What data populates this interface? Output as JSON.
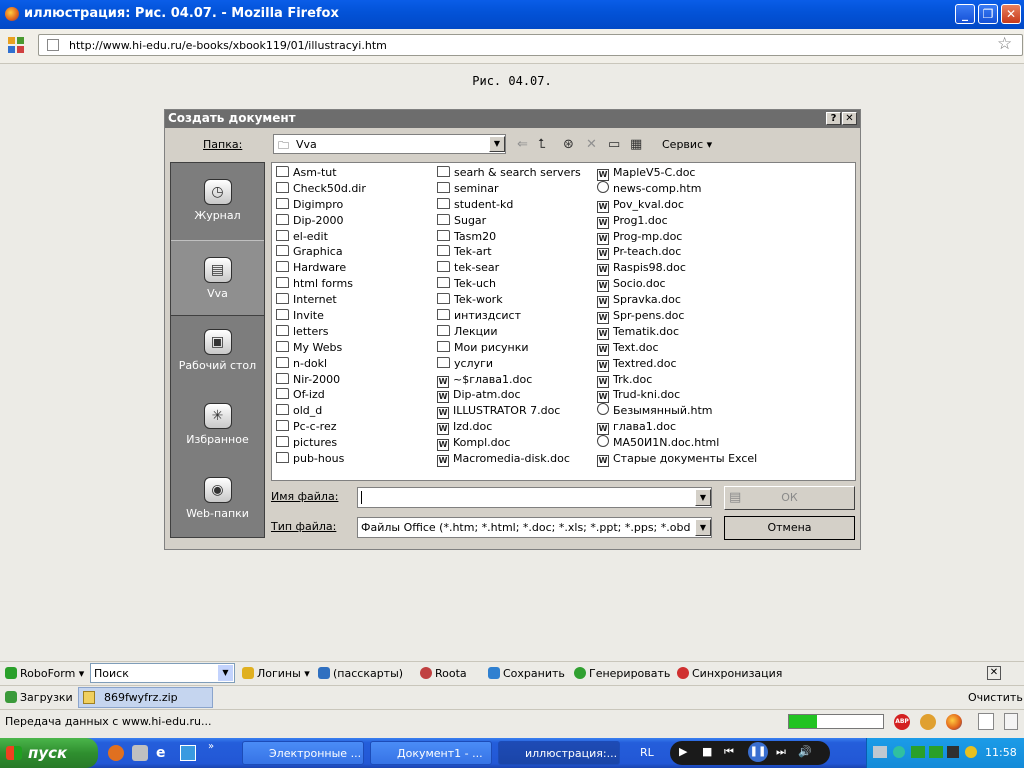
{
  "window": {
    "title": "иллюстрация: Рис. 04.07. - Mozilla Firefox"
  },
  "nav": {
    "url": "http://www.hi-edu.ru/e-books/xbook119/01/illustracyi.htm"
  },
  "page": {
    "caption": "Рис. 04.07."
  },
  "dialog": {
    "title": "Создать документ",
    "folder_label": "Папка:",
    "folder_value": "Vva",
    "tools_label": "Сервис",
    "places": [
      "Журнал",
      "Vva",
      "Рабочий стол",
      "Избранное",
      "Web-папки"
    ],
    "files": {
      "col1": [
        {
          "name": "Asm-tut",
          "type": "folder"
        },
        {
          "name": "Check50d.dir",
          "type": "folder"
        },
        {
          "name": "Digimpro",
          "type": "folder"
        },
        {
          "name": "Dip-2000",
          "type": "folder"
        },
        {
          "name": "el-edit",
          "type": "folder"
        },
        {
          "name": "Graphica",
          "type": "folder"
        },
        {
          "name": "Hardware",
          "type": "folder"
        },
        {
          "name": "html forms",
          "type": "folder"
        },
        {
          "name": "Internet",
          "type": "folder"
        },
        {
          "name": "Invite",
          "type": "folder"
        },
        {
          "name": "letters",
          "type": "folder"
        },
        {
          "name": "My Webs",
          "type": "folder"
        },
        {
          "name": "n-dokl",
          "type": "folder"
        },
        {
          "name": "Nir-2000",
          "type": "folder"
        },
        {
          "name": "Of-izd",
          "type": "folder"
        },
        {
          "name": "old_d",
          "type": "folder"
        },
        {
          "name": "Pc-c-rez",
          "type": "folder"
        },
        {
          "name": "pictures",
          "type": "folder"
        },
        {
          "name": "pub-hous",
          "type": "folder"
        }
      ],
      "col2": [
        {
          "name": "searh & search servers",
          "type": "folder"
        },
        {
          "name": "seminar",
          "type": "folder"
        },
        {
          "name": "student-kd",
          "type": "folder"
        },
        {
          "name": "Sugar",
          "type": "folder"
        },
        {
          "name": "Tasm20",
          "type": "folder"
        },
        {
          "name": "Tek-art",
          "type": "folder"
        },
        {
          "name": "tek-sear",
          "type": "folder"
        },
        {
          "name": "Tek-uch",
          "type": "folder"
        },
        {
          "name": "Tek-work",
          "type": "folder"
        },
        {
          "name": "интиздсист",
          "type": "folder"
        },
        {
          "name": "Лекции",
          "type": "folder"
        },
        {
          "name": "Мои рисунки",
          "type": "folder"
        },
        {
          "name": "услуги",
          "type": "folder"
        },
        {
          "name": "~$глава1.doc",
          "type": "doc"
        },
        {
          "name": "Dip-atm.doc",
          "type": "doc"
        },
        {
          "name": "ILLUSTRATOR 7.doc",
          "type": "doc"
        },
        {
          "name": "Izd.doc",
          "type": "doc"
        },
        {
          "name": "Kompl.doc",
          "type": "doc"
        },
        {
          "name": "Macromedia-disk.doc",
          "type": "doc"
        }
      ],
      "col3": [
        {
          "name": "MapleV5-C.doc",
          "type": "doc"
        },
        {
          "name": "news-comp.htm",
          "type": "htm"
        },
        {
          "name": "Pov_kval.doc",
          "type": "doc"
        },
        {
          "name": "Prog1.doc",
          "type": "doc"
        },
        {
          "name": "Prog-mp.doc",
          "type": "doc"
        },
        {
          "name": "Pr-teach.doc",
          "type": "doc"
        },
        {
          "name": "Raspis98.doc",
          "type": "doc"
        },
        {
          "name": "Socio.doc",
          "type": "doc"
        },
        {
          "name": "Spravka.doc",
          "type": "doc"
        },
        {
          "name": "Spr-pens.doc",
          "type": "doc"
        },
        {
          "name": "Tematik.doc",
          "type": "doc"
        },
        {
          "name": "Text.doc",
          "type": "doc"
        },
        {
          "name": "Textred.doc",
          "type": "doc"
        },
        {
          "name": "Trk.doc",
          "type": "doc"
        },
        {
          "name": "Trud-kni.doc",
          "type": "doc"
        },
        {
          "name": "Безымянный.htm",
          "type": "htm"
        },
        {
          "name": "глава1.doc",
          "type": "doc"
        },
        {
          "name": "MA50И1N.doc.html",
          "type": "htm"
        },
        {
          "name": "Старые документы Excel",
          "type": "doc"
        }
      ]
    },
    "filename_label": "Имя файла:",
    "filename_value": "",
    "filetype_label": "Тип файла:",
    "filetype_value": "Файлы Office (*.htm; *.html; *.doc; *.xls; *.ppt; *.pps; *.obd",
    "ok_label": "ОК",
    "cancel_label": "Отмена"
  },
  "roboform": {
    "brand": "RoboForm",
    "search_placeholder": "Поиск",
    "logins": "Логины",
    "passcards": "(пасскарты)",
    "roota": "Roota",
    "save": "Сохранить",
    "generate": "Генерировать",
    "sync": "Синхронизация"
  },
  "downloads": {
    "label": "Загрузки",
    "file": "869fwyfrz.zip",
    "clear": "Очистить"
  },
  "status": {
    "text": "Передача данных с www.hi-edu.ru...",
    "progress": 0.3
  },
  "taskbar": {
    "start": "пуск",
    "tasks": [
      "Электронные ...",
      "Документ1 - ...",
      "иллюстрация:..."
    ],
    "lang": "RL",
    "clock": "11:58"
  }
}
